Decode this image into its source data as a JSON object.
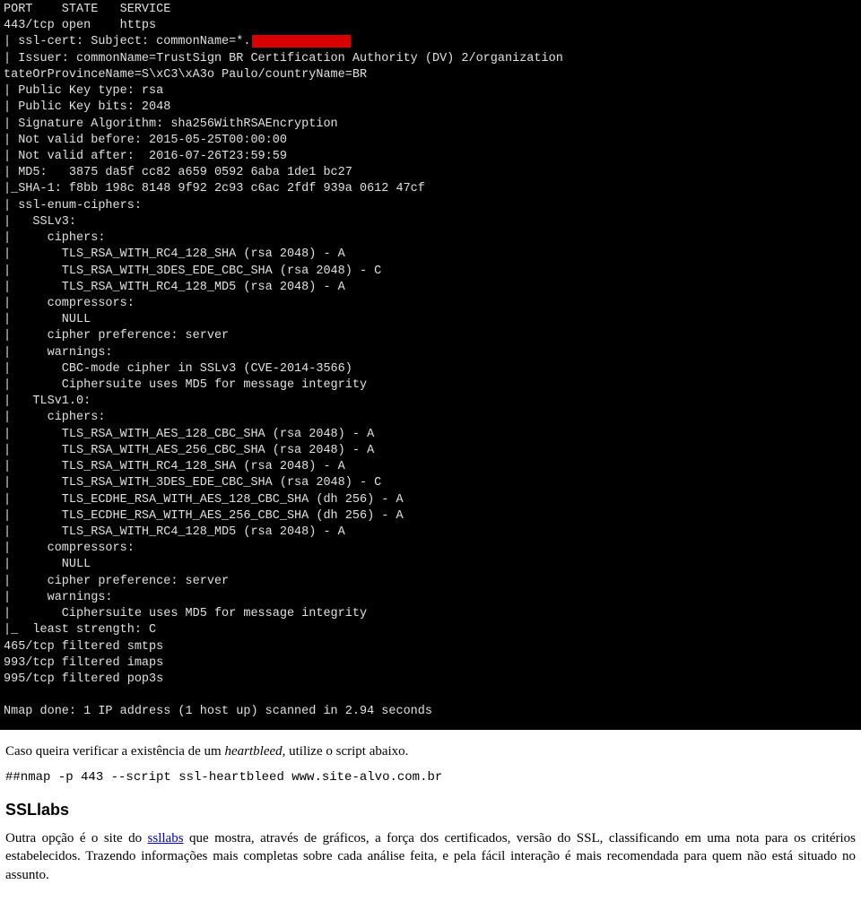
{
  "terminal": {
    "lines": [
      "PORT    STATE   SERVICE",
      "443/tcp open    https",
      "| ssl-cert: Subject: commonName=*.",
      "| Issuer: commonName=TrustSign BR Certification Authority (DV) 2/organization",
      "tateOrProvinceName=S\\xC3\\xA3o Paulo/countryName=BR",
      "| Public Key type: rsa",
      "| Public Key bits: 2048",
      "| Signature Algorithm: sha256WithRSAEncryption",
      "| Not valid before: 2015-05-25T00:00:00",
      "| Not valid after:  2016-07-26T23:59:59",
      "| MD5:   3875 da5f cc82 a659 0592 6aba 1de1 bc27",
      "|_SHA-1: f8bb 198c 8148 9f92 2c93 c6ac 2fdf 939a 0612 47cf",
      "| ssl-enum-ciphers:",
      "|   SSLv3:",
      "|     ciphers:",
      "|       TLS_RSA_WITH_RC4_128_SHA (rsa 2048) - A",
      "|       TLS_RSA_WITH_3DES_EDE_CBC_SHA (rsa 2048) - C",
      "|       TLS_RSA_WITH_RC4_128_MD5 (rsa 2048) - A",
      "|     compressors:",
      "|       NULL",
      "|     cipher preference: server",
      "|     warnings:",
      "|       CBC-mode cipher in SSLv3 (CVE-2014-3566)",
      "|       Ciphersuite uses MD5 for message integrity",
      "|   TLSv1.0:",
      "|     ciphers:",
      "|       TLS_RSA_WITH_AES_128_CBC_SHA (rsa 2048) - A",
      "|       TLS_RSA_WITH_AES_256_CBC_SHA (rsa 2048) - A",
      "|       TLS_RSA_WITH_RC4_128_SHA (rsa 2048) - A",
      "|       TLS_RSA_WITH_3DES_EDE_CBC_SHA (rsa 2048) - C",
      "|       TLS_ECDHE_RSA_WITH_AES_128_CBC_SHA (dh 256) - A",
      "|       TLS_ECDHE_RSA_WITH_AES_256_CBC_SHA (dh 256) - A",
      "|       TLS_RSA_WITH_RC4_128_MD5 (rsa 2048) - A",
      "|     compressors:",
      "|       NULL",
      "|     cipher preference: server",
      "|     warnings:",
      "|       Ciphersuite uses MD5 for message integrity",
      "|_  least strength: C",
      "465/tcp filtered smtps",
      "993/tcp filtered imaps",
      "995/tcp filtered pop3s",
      "",
      "Nmap done: 1 IP address (1 host up) scanned in 2.94 seconds"
    ],
    "redacted_line_index": 2
  },
  "article": {
    "intro_prefix": "Caso queira verificar a existência de um ",
    "intro_italic": "heartbleed,",
    "intro_suffix": " utilize o script abaixo.",
    "command": "##nmap -p 443 --script ssl-heartbleed www.site-alvo.com.br",
    "heading": "SSLlabs",
    "body_prefix": "Outra opção é o site do ",
    "link_text": "ssllabs",
    "body_suffix": " que mostra, através de gráficos, a força dos certificados, versão do SSL, classificando em uma nota para os critérios estabelecidos. Trazendo informações mais completas sobre cada análise feita, e pela fácil interação é mais recomendada para quem não está situado no assunto."
  }
}
